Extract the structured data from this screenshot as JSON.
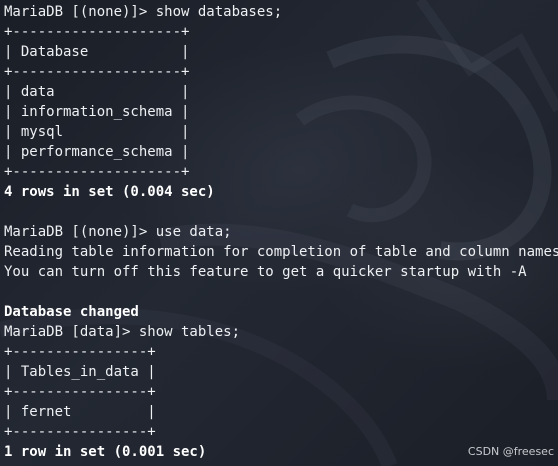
{
  "terminal": {
    "lines": [
      {
        "text": "MariaDB [(none)]> show databases;",
        "bold": false
      },
      {
        "text": "+--------------------+",
        "bold": false
      },
      {
        "text": "| Database           |",
        "bold": false
      },
      {
        "text": "+--------------------+",
        "bold": false
      },
      {
        "text": "| data               |",
        "bold": false
      },
      {
        "text": "| information_schema |",
        "bold": false
      },
      {
        "text": "| mysql              |",
        "bold": false
      },
      {
        "text": "| performance_schema |",
        "bold": false
      },
      {
        "text": "+--------------------+",
        "bold": false
      },
      {
        "text": "4 rows in set (0.004 sec)",
        "bold": true
      },
      {
        "text": "",
        "bold": false
      },
      {
        "text": "MariaDB [(none)]> use data;",
        "bold": false
      },
      {
        "text": "Reading table information for completion of table and column names",
        "bold": false
      },
      {
        "text": "You can turn off this feature to get a quicker startup with -A",
        "bold": false
      },
      {
        "text": "",
        "bold": false
      },
      {
        "text": "Database changed",
        "bold": true
      },
      {
        "text": "MariaDB [data]> show tables;",
        "bold": false
      },
      {
        "text": "+----------------+",
        "bold": false
      },
      {
        "text": "| Tables_in_data |",
        "bold": false
      },
      {
        "text": "+----------------+",
        "bold": false
      },
      {
        "text": "| fernet         |",
        "bold": false
      },
      {
        "text": "+----------------+",
        "bold": false
      },
      {
        "text": "1 row in set (0.001 sec)",
        "bold": true
      }
    ]
  },
  "watermark": "CSDN @freesec"
}
